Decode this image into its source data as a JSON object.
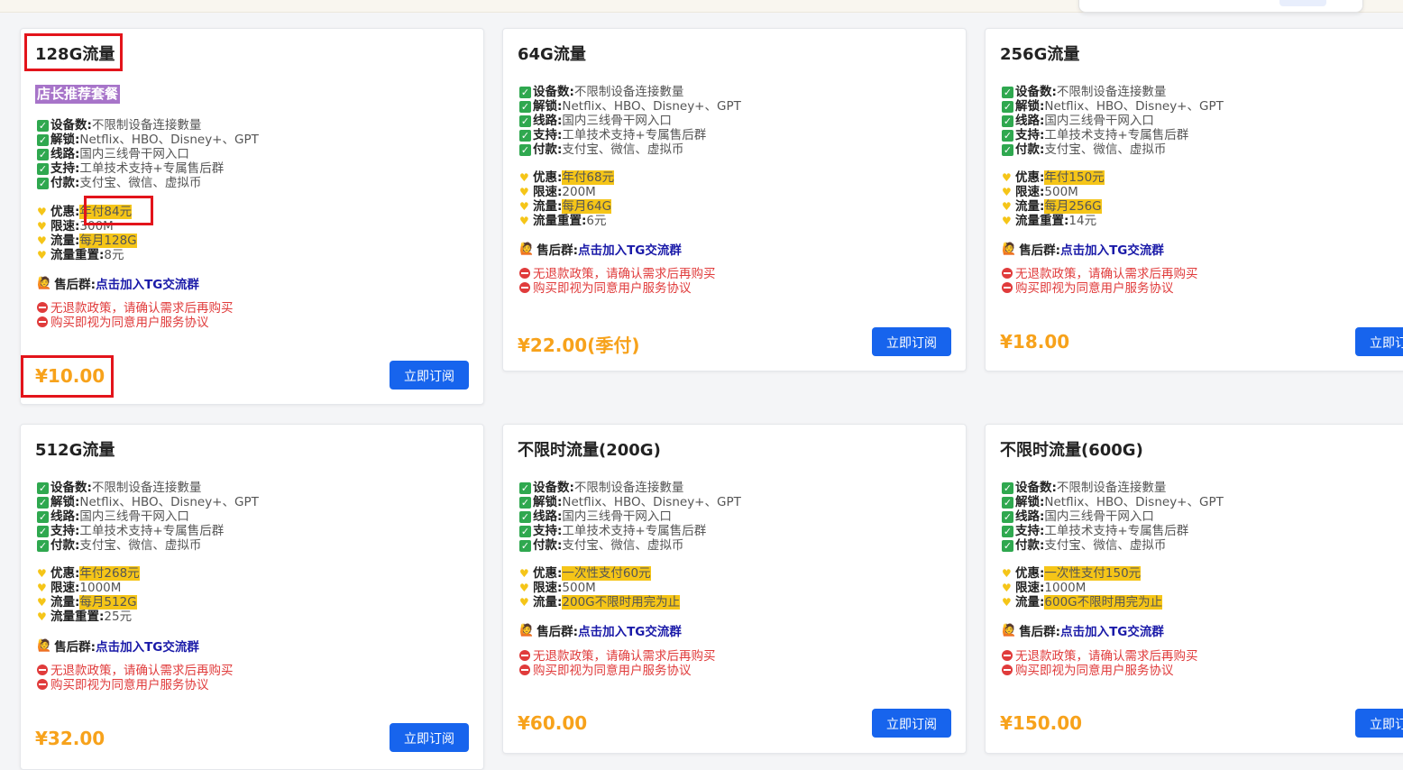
{
  "labels": {
    "devices": "设备数:",
    "unlock": "解锁:",
    "route": "线路:",
    "support": "支持:",
    "payment": "付款:",
    "discount": "优惠:",
    "speed": "限速:",
    "traffic": "流量:",
    "reset": "流量重置:",
    "aftersales": "售后群:"
  },
  "common": {
    "devices_value": "不限制设备连接數量",
    "unlock_value": "Netflix、HBO、Disney+、GPT",
    "route_value": "国内三线骨干网入口",
    "support_value": "工单技术支持+专属售后群",
    "payment_value": "支付宝、微信、虚拟币",
    "aftersales_link": "点击加入TG交流群",
    "policy_1": "无退款政策，请确认需求后再购买",
    "policy_2": "购买即视为同意用户服务协议",
    "subscribe_label": "立即订阅"
  },
  "plans": [
    {
      "title": "128G流量",
      "badge": "店长推荐套餐",
      "discount": "年付84元",
      "speed": "300M",
      "traffic": "每月128G",
      "reset": "8元",
      "price": "¥10.00"
    },
    {
      "title": "64G流量",
      "discount": "年付68元",
      "speed": "200M",
      "traffic": "每月64G",
      "reset": "6元",
      "price": "¥22.00(季付)"
    },
    {
      "title": "256G流量",
      "discount": "年付150元",
      "speed": "500M",
      "traffic": "每月256G",
      "reset": "14元",
      "price": "¥18.00"
    },
    {
      "title": "512G流量",
      "discount": "年付268元",
      "speed": "1000M",
      "traffic": "每月512G",
      "reset": "25元",
      "price": "¥32.00"
    },
    {
      "title": "不限时流量(200G)",
      "discount": "一次性支付60元",
      "speed": "500M",
      "traffic": "200G不限时用完为止",
      "price": "¥60.00"
    },
    {
      "title": "不限时流量(600G)",
      "discount": "一次性支付150元",
      "speed": "1000M",
      "traffic": "600G不限时用完为止",
      "price": "¥150.00"
    }
  ],
  "colors": {
    "accent_blue": "#1764ed",
    "price_orange": "#f7a21b",
    "highlight_yellow": "#f5c518",
    "warning_red": "#e03b3b",
    "badge_purple": "#a774c9",
    "annotation_red": "#e3141b"
  },
  "icons": {
    "check": "check-square-icon",
    "heart": "yellow-heart-icon",
    "person": "person-raising-hand-icon",
    "no_entry": "no-entry-icon"
  }
}
